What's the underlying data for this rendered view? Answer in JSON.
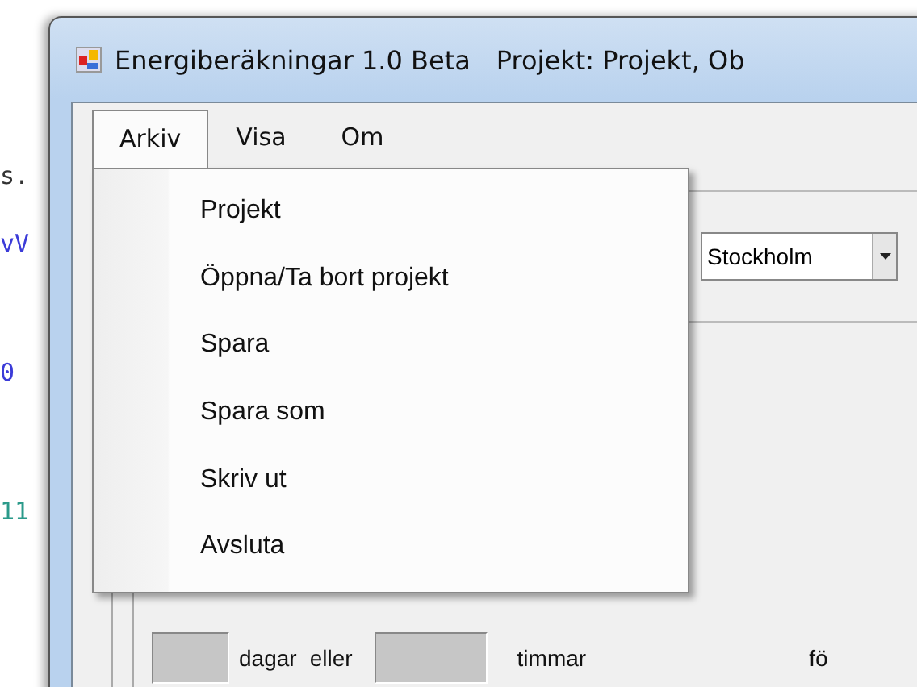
{
  "background_editor": {
    "fragments": [
      "s.",
      "vV",
      "0",
      "11"
    ]
  },
  "window": {
    "title": "Energiberäkningar 1.0 Beta",
    "project": "Projekt: Projekt, Ob"
  },
  "menu_bar": [
    {
      "label": "Arkiv",
      "selected": true
    },
    {
      "label": "Visa",
      "selected": false
    },
    {
      "label": "Om",
      "selected": false
    }
  ],
  "menu": {
    "items": [
      "Projekt",
      "Öppna/Ta bort projekt",
      "Spara",
      "Spara som",
      "Skriv ut",
      "Avsluta"
    ]
  },
  "city_dropdown": {
    "value": "Stockholm"
  },
  "period_row": {
    "days_label": "dagar",
    "or_label": "eller",
    "hours_label": "timmar",
    "cut_label": "fö"
  }
}
